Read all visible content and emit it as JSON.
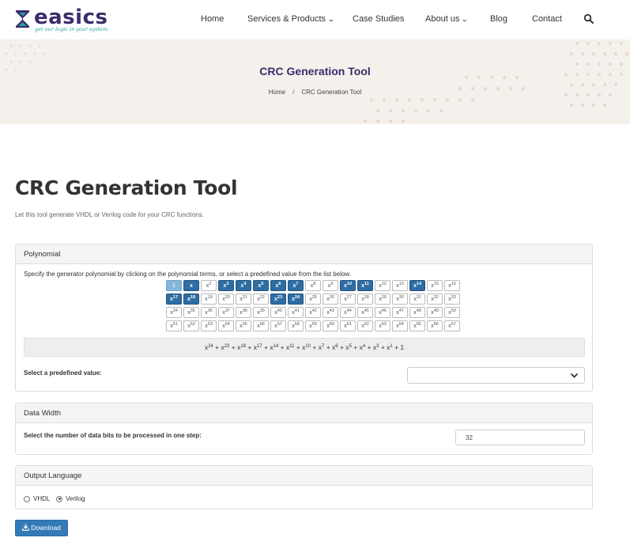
{
  "brand": {
    "name": "easics",
    "tagline": "get our logic in your system",
    "color": "#3b2c6b",
    "tagline_color": "#2aa198"
  },
  "nav": [
    {
      "label": "Home"
    },
    {
      "label": "Services & Products",
      "dropdown": true
    },
    {
      "label": "Case Studies"
    },
    {
      "label": "About us",
      "dropdown": true
    },
    {
      "label": "Blog"
    },
    {
      "label": "Contact"
    }
  ],
  "banner": {
    "title": "CRC Generation Tool",
    "breadcrumb": [
      "Home",
      "/",
      "CRC Generation Tool"
    ]
  },
  "page": {
    "title": "CRC Generation Tool",
    "intro": "Let this tool generate VHDL or Verilog code for your CRC functions."
  },
  "polynomial": {
    "heading": "Polynomial",
    "instruction": "Specify the generator polynomial by clicking on the polynomial terms, or select a predefined value from the list below.",
    "selected_terms": [
      0,
      1,
      3,
      4,
      5,
      6,
      7,
      10,
      11,
      14,
      17,
      18,
      23,
      24
    ],
    "expression": "x24 + x23 + x18 + x17 + x14 + x11 + x10 + x7 + x6 + x5 + x4 + x3 + x1 + 1",
    "predefined_label": "Select a predefined value:",
    "predefined_value": ""
  },
  "data_width": {
    "heading": "Data Width",
    "label": "Select the number of data bits to be processed in one step:",
    "value": "32"
  },
  "output_language": {
    "heading": "Output Language",
    "options": [
      {
        "label": "VHDL",
        "selected": false
      },
      {
        "label": "Verilog",
        "selected": true
      }
    ]
  },
  "download_label": "Download",
  "colors": {
    "selected_term": "#2e6da4",
    "button": "#337ab7",
    "banner_bg": "#f4f0ec"
  }
}
